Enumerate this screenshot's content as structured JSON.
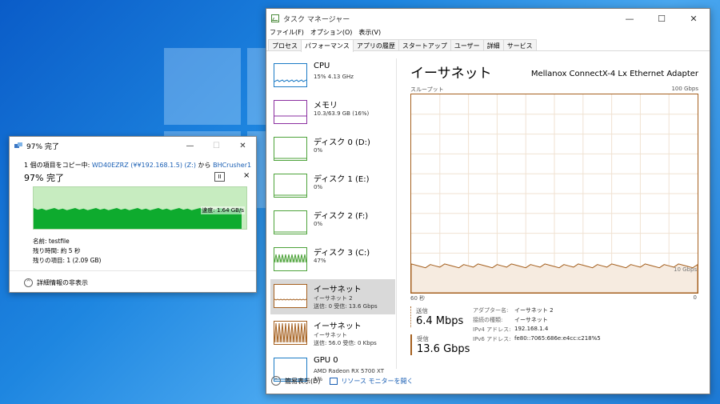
{
  "copy_dialog": {
    "title": "97% 完了",
    "from_prefix": "1 個の項目をコピー中:",
    "from_source": "WD40EZRZ (¥¥192.168.1.5) (Z:)",
    "from_mid": "から",
    "from_dest": "BHCrusher1",
    "percent_label": "97% 完了",
    "progress": 0.97,
    "speed_label": "速度: 1.64 GB/s",
    "name_label": "名前: testfile",
    "remaining_time": "残り時間: 約 5 秒",
    "remaining_items": "残りの項目: 1 (2.09 GB)",
    "details_toggle": "詳細情報の非表示",
    "pause_glyph": "II",
    "close_glyph": "×"
  },
  "task_manager": {
    "title": "タスク マネージャー",
    "menu": [
      "ファイル(F)",
      "オプション(O)",
      "表示(V)"
    ],
    "tabs": [
      "プロセス",
      "パフォーマンス",
      "アプリの履歴",
      "スタートアップ",
      "ユーザー",
      "詳細",
      "サービス"
    ],
    "active_tab": "パフォーマンス",
    "sidebar": [
      {
        "name": "CPU",
        "sub1": "15%  4.13 GHz",
        "sub2": "",
        "color": "#1b7ac5"
      },
      {
        "name": "メモリ",
        "sub1": "10.3/63.9 GB (16%)",
        "sub2": "",
        "color": "#8b2fa0"
      },
      {
        "name": "ディスク 0 (D:)",
        "sub1": "0%",
        "sub2": "",
        "color": "#4da33a"
      },
      {
        "name": "ディスク 1 (E:)",
        "sub1": "0%",
        "sub2": "",
        "color": "#4da33a"
      },
      {
        "name": "ディスク 2 (F:)",
        "sub1": "0%",
        "sub2": "",
        "color": "#4da33a"
      },
      {
        "name": "ディスク 3 (C:)",
        "sub1": "47%",
        "sub2": "",
        "color": "#4da33a"
      },
      {
        "name": "イーサネット",
        "sub1": "イーサネット 2",
        "sub2": "送信: 0  受信: 13.6 Gbps",
        "color": "#a5601f"
      },
      {
        "name": "イーサネット",
        "sub1": "イーサネット",
        "sub2": "送信: 56.0  受信: 0 Kbps",
        "color": "#a5601f"
      },
      {
        "name": "GPU 0",
        "sub1": "AMD Radeon RX 5700 XT",
        "sub2": "1%",
        "color": "#1b7ac5"
      }
    ],
    "selected_index": 6,
    "main": {
      "title": "イーサネット",
      "adapter": "Mellanox ConnectX-4 Lx Ethernet Adapter",
      "throughput_label": "スループット",
      "max_label": "100 Gbps",
      "line_label": "10 Gbps",
      "x_left": "60 秒",
      "x_right": "0",
      "send_label": "送信",
      "send_value": "6.4 Mbps",
      "recv_label": "受信",
      "recv_value": "13.6 Gbps",
      "props": [
        {
          "k": "アダプター名:",
          "v": "イーサネット 2"
        },
        {
          "k": "接続の種類:",
          "v": "イーサネット"
        },
        {
          "k": "IPv4 アドレス:",
          "v": "192.168.1.4"
        },
        {
          "k": "IPv6 アドレス:",
          "v": "fe80::7065:686e:e4cc:c218%5"
        }
      ]
    },
    "footer": {
      "summary": "簡易表示(D)",
      "resource_monitor": "リソース モニターを開く"
    },
    "accent": "#a5601f"
  }
}
